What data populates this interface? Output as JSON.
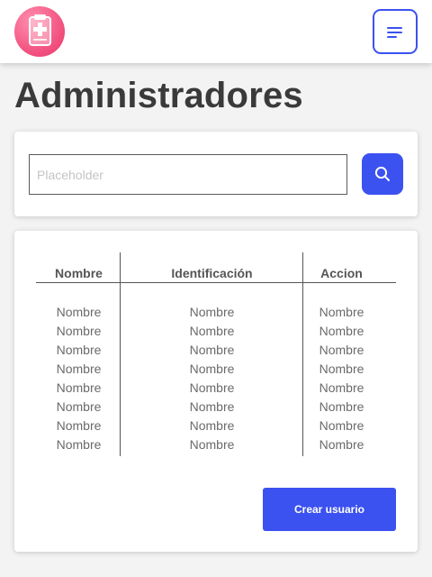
{
  "header": {
    "logo_icon": "clipboard-medical-icon",
    "menu_icon": "hamburger-menu-icon"
  },
  "page": {
    "title": "Administradores"
  },
  "search": {
    "placeholder": "Placeholder",
    "value": "",
    "button_icon": "search-icon"
  },
  "table": {
    "headers": [
      "Nombre",
      "Identificación",
      "Accion"
    ],
    "rows": [
      [
        "Nombre",
        "Nombre",
        "Nombre"
      ],
      [
        "Nombre",
        "Nombre",
        "Nombre"
      ],
      [
        "Nombre",
        "Nombre",
        "Nombre"
      ],
      [
        "Nombre",
        "Nombre",
        "Nombre"
      ],
      [
        "Nombre",
        "Nombre",
        "Nombre"
      ],
      [
        "Nombre",
        "Nombre",
        "Nombre"
      ],
      [
        "Nombre",
        "Nombre",
        "Nombre"
      ],
      [
        "Nombre",
        "Nombre",
        "Nombre"
      ]
    ]
  },
  "actions": {
    "create_label": "Crear usuario"
  },
  "colors": {
    "accent": "#3b51f0",
    "logo": "#f45a86",
    "background": "#f3f3f3",
    "card": "#ffffff"
  }
}
